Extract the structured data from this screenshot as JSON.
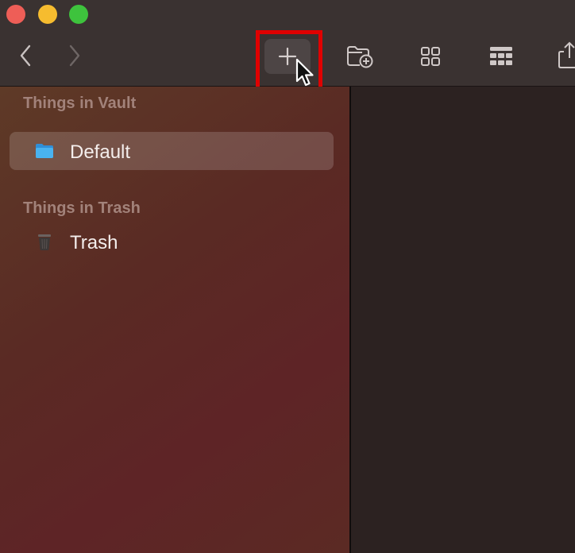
{
  "window": {
    "traffic_lights": {
      "close_color": "#ee5e57",
      "minimize_color": "#f6bc2f",
      "zoom_color": "#3ec33d"
    }
  },
  "toolbar": {
    "back_icon": "chevron-left",
    "forward_icon": "chevron-right",
    "buttons": [
      {
        "name": "add-item",
        "icon": "plus-icon",
        "highlighted": true
      },
      {
        "name": "new-folder",
        "icon": "folder-plus-icon"
      },
      {
        "name": "grid-view",
        "icon": "grid-icon"
      },
      {
        "name": "table-view",
        "icon": "table-icon"
      },
      {
        "name": "share",
        "icon": "share-icon"
      }
    ],
    "highlight_color": "#e00000"
  },
  "sidebar": {
    "sections": [
      {
        "title": "Things in Vault",
        "items": [
          {
            "label": "Default",
            "icon": "folder-icon",
            "selected": true
          }
        ]
      },
      {
        "title": "Things in Trash",
        "items": [
          {
            "label": "Trash",
            "icon": "trash-icon",
            "selected": false
          }
        ]
      }
    ]
  }
}
